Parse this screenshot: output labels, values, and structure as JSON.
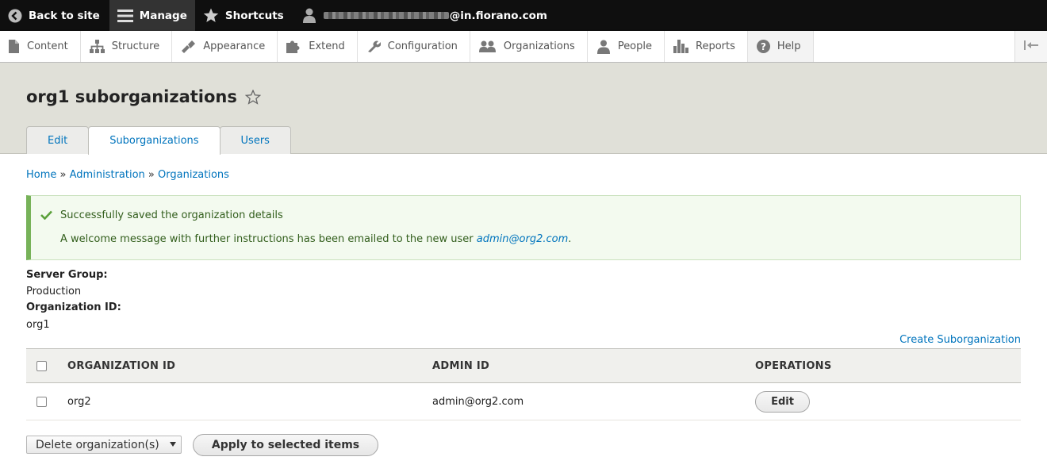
{
  "topbar": {
    "back_label": "Back to site",
    "manage_label": "Manage",
    "shortcuts_label": "Shortcuts",
    "user_domain": "@in.fiorano.com"
  },
  "tray": {
    "items": [
      {
        "label": "Content",
        "icon": "file-icon"
      },
      {
        "label": "Structure",
        "icon": "sitemap-icon"
      },
      {
        "label": "Appearance",
        "icon": "paintbrush-icon"
      },
      {
        "label": "Extend",
        "icon": "puzzle-icon"
      },
      {
        "label": "Configuration",
        "icon": "wrench-icon"
      },
      {
        "label": "Organizations",
        "icon": "people-icon"
      },
      {
        "label": "People",
        "icon": "person-icon"
      },
      {
        "label": "Reports",
        "icon": "bar-chart-icon"
      },
      {
        "label": "Help",
        "icon": "help-icon"
      }
    ]
  },
  "page": {
    "title": "org1 suborganizations",
    "tabs": [
      {
        "label": "Edit",
        "active": false
      },
      {
        "label": "Suborganizations",
        "active": true
      },
      {
        "label": "Users",
        "active": false
      }
    ]
  },
  "breadcrumb": {
    "home": "Home",
    "sep": "»",
    "administration": "Administration",
    "organizations": "Organizations"
  },
  "message": {
    "line1": "Successfully saved the organization details",
    "line2_prefix": "A welcome message with further instructions has been emailed to the new user ",
    "line2_email": "admin@org2.com",
    "line2_suffix": "."
  },
  "details": {
    "server_group_label": "Server Group:",
    "server_group_value": "Production",
    "org_id_label": "Organization ID:",
    "org_id_value": "org1"
  },
  "create_link": "Create Suborganization",
  "table": {
    "headers": [
      "ORGANIZATION ID",
      "ADMIN ID",
      "OPERATIONS"
    ],
    "rows": [
      {
        "org_id": "org2",
        "admin_id": "admin@org2.com",
        "operation": "Edit"
      }
    ]
  },
  "bulk": {
    "selected_action": "Delete organization(s)",
    "apply_label": "Apply to selected items"
  },
  "colors": {
    "toolbar_bg": "#0f0f0f",
    "link": "#0074bd",
    "header_bg": "#e0e0d8",
    "success_border": "#77b259",
    "success_bg": "#f3faef"
  }
}
